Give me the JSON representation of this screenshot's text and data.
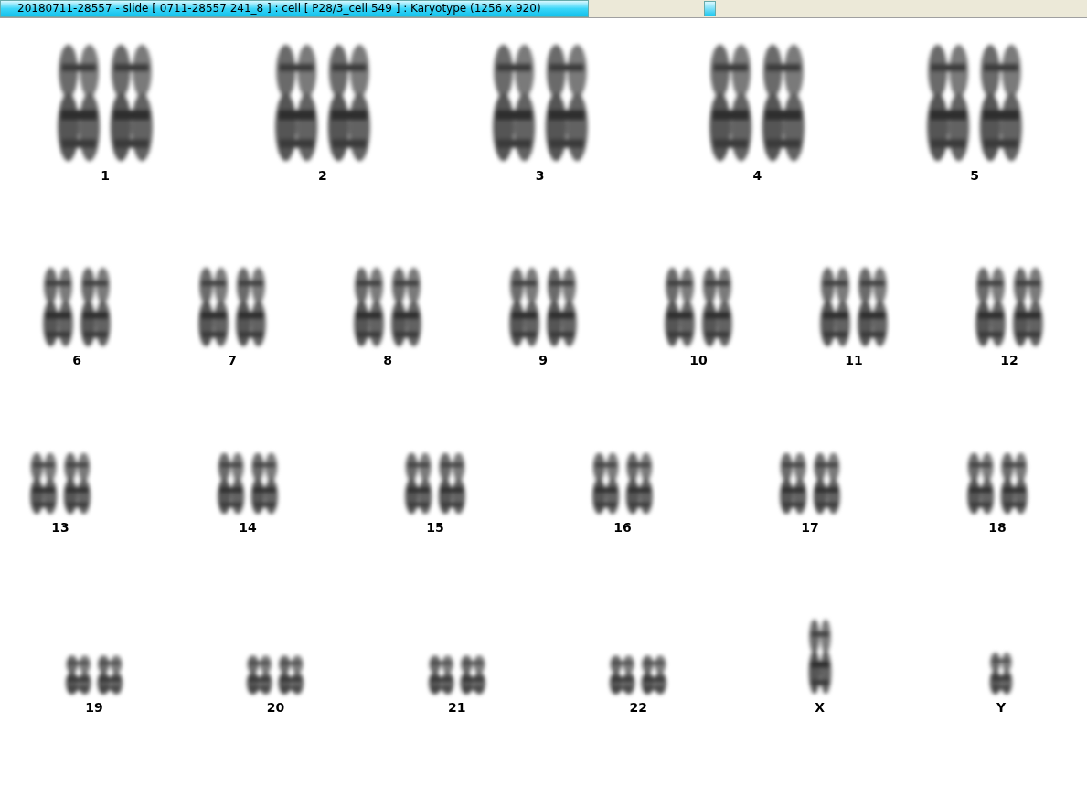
{
  "window": {
    "title": "20180711-28557 - slide [ 0711-28557 241_8 ] : cell [ P28/3_cell 549 ] : Karyotype  (1256 x 920)"
  },
  "karyotype": {
    "rows": [
      {
        "chromosomes": [
          {
            "label": "1",
            "kind": "pair"
          },
          {
            "label": "2",
            "kind": "pair"
          },
          {
            "label": "3",
            "kind": "pair"
          },
          {
            "label": "4",
            "kind": "pair"
          },
          {
            "label": "5",
            "kind": "pair"
          }
        ]
      },
      {
        "chromosomes": [
          {
            "label": "6",
            "kind": "pair"
          },
          {
            "label": "7",
            "kind": "pair"
          },
          {
            "label": "8",
            "kind": "pair"
          },
          {
            "label": "9",
            "kind": "pair"
          },
          {
            "label": "10",
            "kind": "pair"
          },
          {
            "label": "11",
            "kind": "pair"
          },
          {
            "label": "12",
            "kind": "pair"
          }
        ]
      },
      {
        "chromosomes": [
          {
            "label": "13",
            "kind": "pair"
          },
          {
            "label": "14",
            "kind": "pair"
          },
          {
            "label": "15",
            "kind": "pair"
          },
          {
            "label": "16",
            "kind": "pair"
          },
          {
            "label": "17",
            "kind": "pair"
          },
          {
            "label": "18",
            "kind": "pair"
          }
        ]
      },
      {
        "chromosomes": [
          {
            "label": "19",
            "kind": "pair"
          },
          {
            "label": "20",
            "kind": "pair"
          },
          {
            "label": "21",
            "kind": "pair"
          },
          {
            "label": "22",
            "kind": "pair"
          },
          {
            "label": "X",
            "kind": "single"
          },
          {
            "label": "Y",
            "kind": "single"
          }
        ]
      }
    ]
  }
}
